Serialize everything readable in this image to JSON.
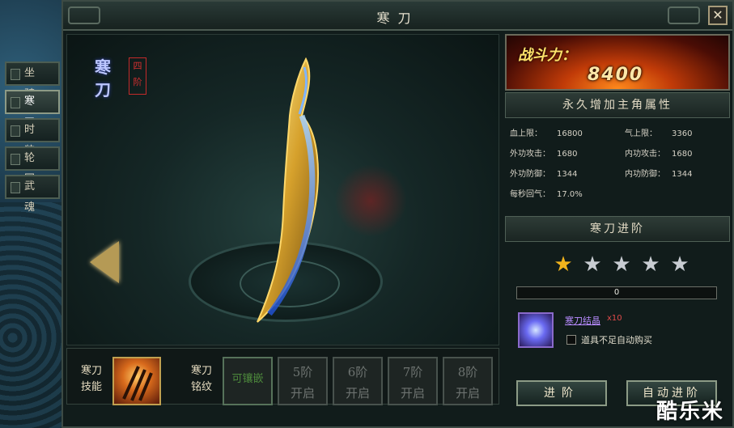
{
  "window": {
    "title": "寒刀",
    "close_symbol": "✕"
  },
  "side_tabs": [
    {
      "label": "坐骑",
      "active": false
    },
    {
      "label": "寒刀",
      "active": true
    },
    {
      "label": "时装",
      "active": false
    },
    {
      "label": "轮回",
      "active": false
    },
    {
      "label": "武魂",
      "active": false
    }
  ],
  "stage": {
    "name": "寒刀",
    "grade": "四阶"
  },
  "skill": {
    "label_line1": "寒刀",
    "label_line2": "技能"
  },
  "inscription": {
    "label_line1": "寒刀",
    "label_line2": "铭纹",
    "slots": [
      {
        "text": "可镶嵌",
        "open": true
      },
      {
        "line1": "5阶",
        "line2": "开启",
        "open": false
      },
      {
        "line1": "6阶",
        "line2": "开启",
        "open": false
      },
      {
        "line1": "7阶",
        "line2": "开启",
        "open": false
      },
      {
        "line1": "8阶",
        "line2": "开启",
        "open": false
      }
    ]
  },
  "power": {
    "label": "战斗力：",
    "value": "8400"
  },
  "attributes": {
    "header": "永久增加主角属性",
    "rows": [
      {
        "key": "血上限：",
        "value": "16800"
      },
      {
        "key": "气上限：",
        "value": "3360"
      },
      {
        "key": "外功攻击：",
        "value": "1680"
      },
      {
        "key": "内功攻击：",
        "value": "1680"
      },
      {
        "key": "外功防御：",
        "value": "1344"
      },
      {
        "key": "内功防御：",
        "value": "1344"
      },
      {
        "key": "每秒回气：",
        "value": "17.0%"
      }
    ]
  },
  "advance": {
    "header": "寒刀进阶",
    "stars_total": 5,
    "stars_filled": 1,
    "star_colors": {
      "filled": "#f2b41c",
      "empty": "#c8ccd2"
    },
    "progress_value": "0",
    "progress_fraction": 0,
    "item_name": "寒刀结晶",
    "item_count": "x10",
    "auto_buy_label": "道具不足自动购买",
    "btn_advance": "进阶",
    "btn_auto": "自动进阶"
  },
  "watermark": "酷乐米"
}
